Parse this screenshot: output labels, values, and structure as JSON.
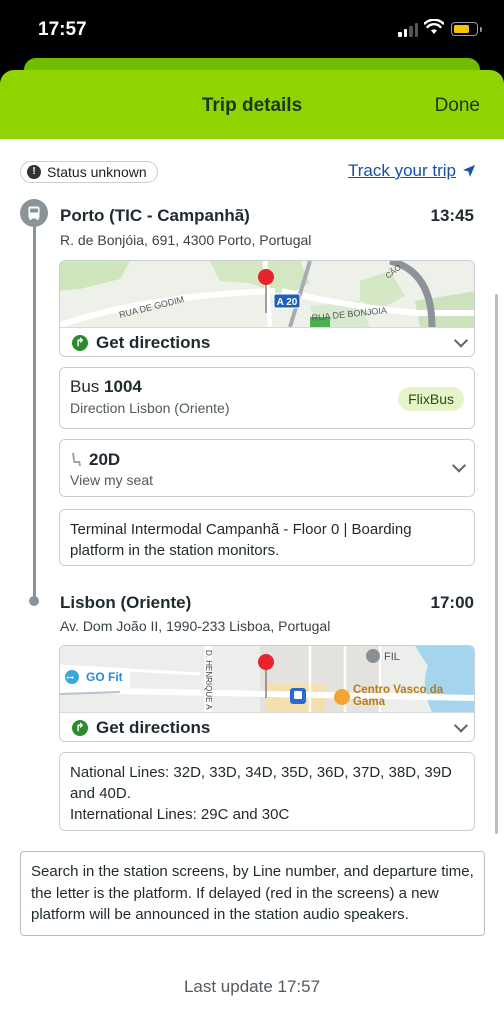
{
  "status_bar": {
    "time": "17:57"
  },
  "header": {
    "title": "Trip details",
    "done_label": "Done"
  },
  "trip": {
    "status_label": "Status unknown",
    "track_label": "Track your trip",
    "departure": {
      "name": "Porto (TIC - Campanhã)",
      "time": "13:45",
      "address": "R. de Bonjóia, 691, 4300 Porto, Portugal",
      "directions_label": "Get directions",
      "map_labels": {
        "street1": "RUA DE GODIM",
        "highway": "A 20",
        "street2": "RUA DE BONJOIA",
        "corner": "CÃO"
      }
    },
    "bus": {
      "prefix": "Bus",
      "number": "1004",
      "direction": "Direction Lisbon (Oriente)",
      "operator": "FlixBus"
    },
    "seat": {
      "number": "20D",
      "sub_label": "View my seat"
    },
    "departure_note": "Terminal Intermodal Campanhã - Floor 0 | Boarding platform in the station monitors.",
    "arrival": {
      "name": "Lisbon (Oriente)",
      "time": "17:00",
      "address": "Av. Dom João II, 1990-233 Lisboa, Portugal",
      "directions_label": "Get directions",
      "map_labels": {
        "gym": "GO Fit",
        "street": "D. HENRIQUE A",
        "fil": "FIL",
        "mall": "Centro Vasco da Gama"
      }
    },
    "arrival_note": "National Lines: 32D, 33D, 34D, 35D, 36D, 37D, 38D, 39D and 40D.\nInternational Lines: 29C and 30C"
  },
  "search_note": "Search in the station screens, by Line number, and departure time, the letter is the platform. If delayed (red in the screens) a new platform will be announced in the station audio speakers.",
  "last_update": "Last update 17:57",
  "colors": {
    "brand_green": "#8fd400",
    "link_blue": "#1a4fa8",
    "pin_red": "#e8232b",
    "highway_blue": "#1b5fbf"
  }
}
